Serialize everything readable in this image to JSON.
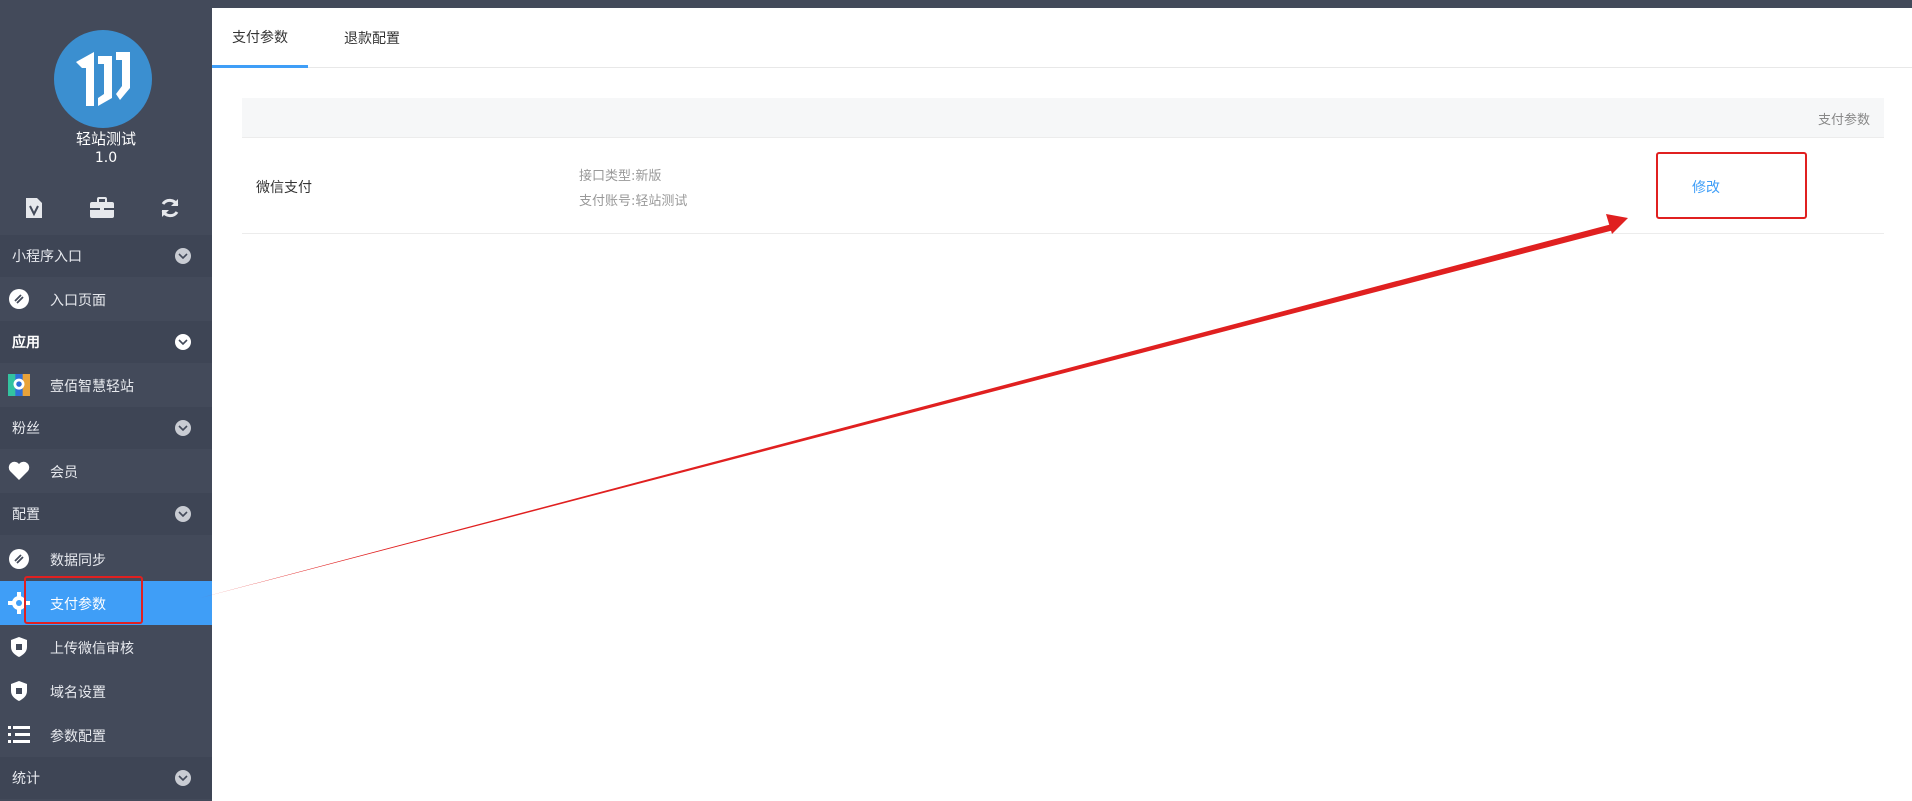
{
  "brand": {
    "name": "轻站测试",
    "version": "1.0"
  },
  "toolbar": {
    "icons": [
      "doc-v-icon",
      "briefcase-icon",
      "refresh-icon"
    ]
  },
  "sidebar": {
    "groups": [
      {
        "label": "小程序入口",
        "items": [
          {
            "label": "入口页面",
            "icon": "link-icon"
          }
        ]
      },
      {
        "label": "应用",
        "items": [
          {
            "label": "壹佰智慧轻站",
            "icon": "app-logo-icon"
          }
        ]
      },
      {
        "label": "粉丝",
        "items": [
          {
            "label": "会员",
            "icon": "heart-icon"
          }
        ]
      },
      {
        "label": "配置",
        "items": [
          {
            "label": "数据同步",
            "icon": "link-icon"
          },
          {
            "label": "支付参数",
            "icon": "gear-icon",
            "active": true
          },
          {
            "label": "上传微信审核",
            "icon": "shield-icon"
          },
          {
            "label": "域名设置",
            "icon": "shield-icon"
          },
          {
            "label": "参数配置",
            "icon": "list-icon"
          }
        ]
      },
      {
        "label": "统计",
        "items": []
      }
    ]
  },
  "tabs": [
    {
      "label": "支付参数",
      "active": true
    },
    {
      "label": "退款配置",
      "active": false
    }
  ],
  "table": {
    "header_right": "支付参数",
    "rows": [
      {
        "name": "微信支付",
        "info": [
          "接口类型:新版",
          "支付账号:轻站测试"
        ],
        "action": "修改"
      }
    ]
  },
  "colors": {
    "sidebar_bg": "#434a5a",
    "group_bg": "#3e4555",
    "active_item": "#3f9ef7",
    "accent": "#3f9ef7",
    "annotation": "#e02020"
  }
}
